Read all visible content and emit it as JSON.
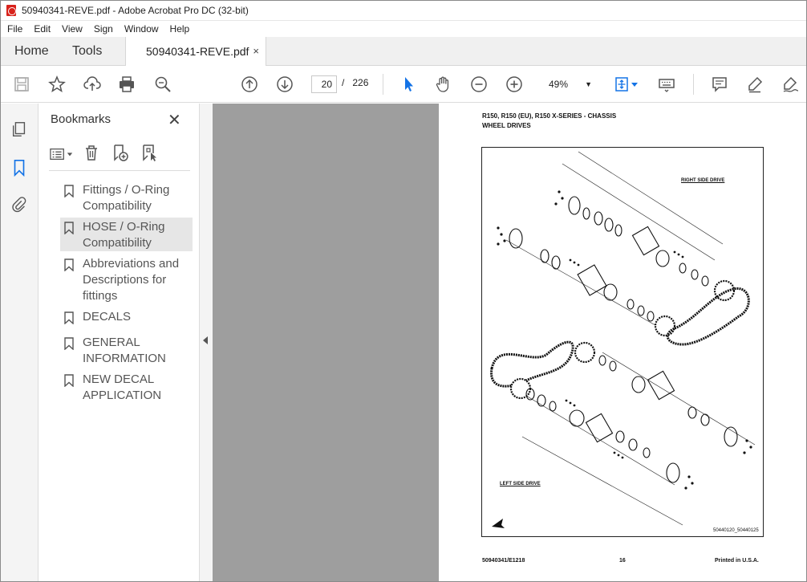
{
  "window": {
    "title": "50940341-REVE.pdf - Adobe Acrobat Pro DC (32-bit)"
  },
  "menu": [
    "File",
    "Edit",
    "View",
    "Sign",
    "Window",
    "Help"
  ],
  "tabs": {
    "home": "Home",
    "tools": "Tools",
    "document": "50940341-REVE.pdf",
    "close_glyph": "×"
  },
  "toolbar": {
    "page_current": "20",
    "page_separator": "/",
    "page_total": "226",
    "zoom": "49%"
  },
  "bookmarks": {
    "title": "Bookmarks",
    "items": [
      {
        "label": "Fittings / O-Ring Compatibility",
        "selected": false
      },
      {
        "label": "HOSE / O-Ring Compatibility",
        "selected": true
      },
      {
        "label": "Abbreviations and Descriptions for fittings",
        "selected": false
      },
      {
        "label": "DECALS",
        "selected": false
      },
      {
        "label": "GENERAL INFORMATION",
        "selected": false
      },
      {
        "label": "NEW DECAL APPLICATION",
        "selected": false
      }
    ]
  },
  "pdf_page": {
    "header_line1": "R150, R150 (EU), R150 X-SERIES -  CHASSIS",
    "header_line2": "WHEEL DRIVES",
    "label_right": "RIGHT SIDE DRIVE",
    "label_left": "LEFT SIDE DRIVE",
    "figure_id": "50440120_50440125",
    "footer_left": "50940341/E1218",
    "footer_center": "16",
    "footer_right": "Printed in U.S.A."
  },
  "colors": {
    "accent_blue": "#1473e6",
    "viewer_bg": "#9e9e9e",
    "pdf_red": "#d8221b"
  }
}
